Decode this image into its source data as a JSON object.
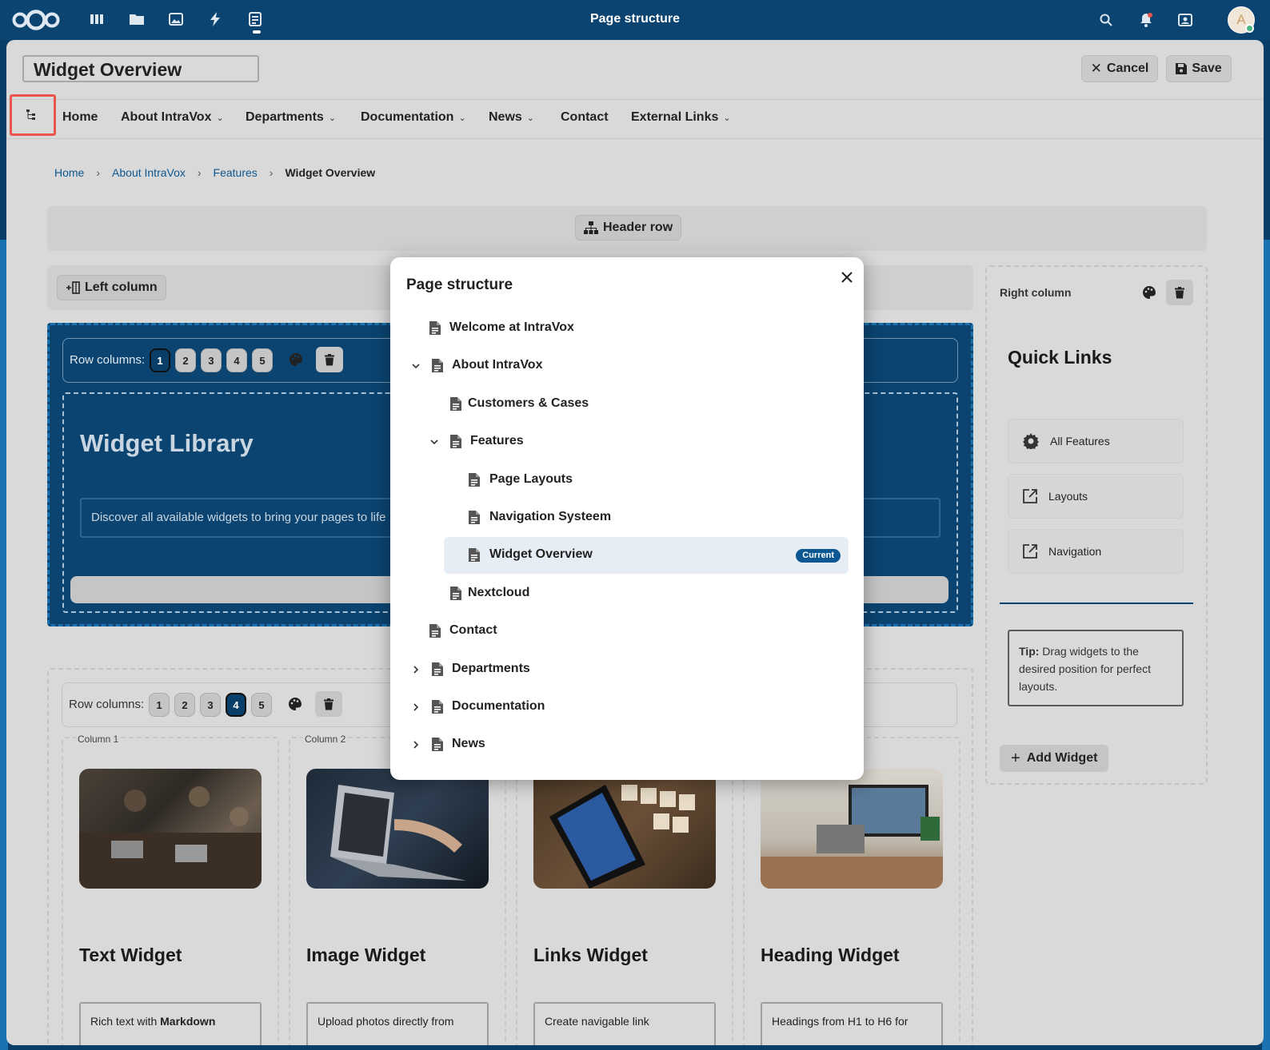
{
  "topbar": {
    "title": "Page structure",
    "apps": [
      "dashboard-icon",
      "files-icon",
      "photos-icon",
      "activity-icon",
      "intravox-icon"
    ],
    "right_icons": [
      "search-icon",
      "notifications-icon",
      "contacts-icon"
    ],
    "avatar_initial": "A"
  },
  "header": {
    "page_title": "Widget Overview",
    "cancel_label": "Cancel",
    "save_label": "Save"
  },
  "nav": {
    "items": [
      {
        "label": "Home",
        "has_menu": false
      },
      {
        "label": "About IntraVox",
        "has_menu": true
      },
      {
        "label": "Departments",
        "has_menu": true
      },
      {
        "label": "Documentation",
        "has_menu": true
      },
      {
        "label": "News",
        "has_menu": true
      },
      {
        "label": "Contact",
        "has_menu": false
      },
      {
        "label": "External Links",
        "has_menu": true
      }
    ]
  },
  "breadcrumb": {
    "items": [
      "Home",
      "About IntraVox",
      "Features"
    ],
    "current": "Widget Overview",
    "separator": "›"
  },
  "layout": {
    "header_row_label": "Header row",
    "left_column_label": "Left column",
    "right_column_label": "Right column",
    "row_columns_label": "Row columns:",
    "row_numbers": [
      "1",
      "2",
      "3",
      "4",
      "5"
    ],
    "row1_selected": "1",
    "row2_selected": "4",
    "column1_label": "Column 1",
    "column2_label": "Column 2"
  },
  "widget_library": {
    "title": "Widget Library",
    "text": "Discover all available widgets to bring your pages to life"
  },
  "widgets": [
    {
      "title": "Text Widget",
      "text_before": "Rich text with ",
      "text_bold": "Markdown"
    },
    {
      "title": "Image Widget",
      "text_before": "Upload photos directly from",
      "text_bold": ""
    },
    {
      "title": "Links Widget",
      "text_before": "Create navigable link",
      "text_bold": ""
    },
    {
      "title": "Heading Widget",
      "text_before": "Headings from H1 to H6 for",
      "text_bold": ""
    }
  ],
  "quick_links": {
    "title": "Quick Links",
    "items": [
      {
        "label": "All Features",
        "icon": "gear-icon"
      },
      {
        "label": "Layouts",
        "icon": "external-link-icon"
      },
      {
        "label": "Navigation",
        "icon": "external-link-icon"
      }
    ],
    "tip_bold": "Tip:",
    "tip_text": " Drag widgets to the desired position for perfect layouts.",
    "add_widget_label": "Add Widget"
  },
  "modal": {
    "title": "Page structure",
    "current_badge": "Current",
    "tree": [
      {
        "label": "Welcome at IntraVox",
        "level": 0,
        "twisty": "none",
        "current": false
      },
      {
        "label": "About IntraVox",
        "level": 0,
        "twisty": "expanded",
        "current": false
      },
      {
        "label": "Customers & Cases",
        "level": 1,
        "twisty": "none",
        "current": false
      },
      {
        "label": "Features",
        "level": 1,
        "twisty": "expanded",
        "current": false
      },
      {
        "label": "Page Layouts",
        "level": 2,
        "twisty": "none",
        "current": false
      },
      {
        "label": "Navigation Systeem",
        "level": 2,
        "twisty": "none",
        "current": false
      },
      {
        "label": "Widget Overview",
        "level": 2,
        "twisty": "none",
        "current": true
      },
      {
        "label": "Nextcloud",
        "level": 1,
        "twisty": "none",
        "current": false
      },
      {
        "label": "Contact",
        "level": 0,
        "twisty": "none",
        "current": false
      },
      {
        "label": "Departments",
        "level": 0,
        "twisty": "collapsed",
        "current": false
      },
      {
        "label": "Documentation",
        "level": 0,
        "twisty": "collapsed",
        "current": false
      },
      {
        "label": "News",
        "level": 0,
        "twisty": "collapsed",
        "current": false
      }
    ]
  },
  "colors": {
    "brand_blue": "#0b4470",
    "accent_blue": "#0b5791",
    "highlight_red": "#e8554c",
    "current_row_bg": "#e6edf4"
  }
}
